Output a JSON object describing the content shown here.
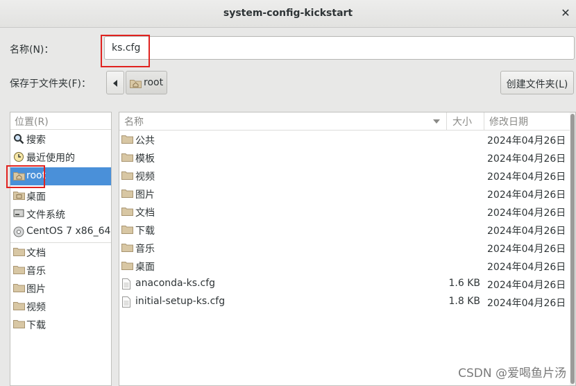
{
  "window": {
    "title": "system-config-kickstart"
  },
  "name_row": {
    "label": "名称(N)：",
    "value": "ks.cfg"
  },
  "folder_row": {
    "label": "保存于文件夹(F)：",
    "current": "root",
    "new_folder_label": "创建文件夹(L)"
  },
  "sidebar": {
    "header": "位置(R)",
    "items": [
      {
        "label": "搜索",
        "icon": "search-icon"
      },
      {
        "label": "最近使用的",
        "icon": "recent-icon"
      },
      {
        "label": "root",
        "icon": "home-folder-icon",
        "selected": true
      },
      {
        "label": "桌面",
        "icon": "desktop-folder-icon"
      },
      {
        "label": "文件系统",
        "icon": "drive-icon"
      },
      {
        "label": "CentOS 7 x86_64",
        "icon": "disc-icon"
      },
      {
        "label": "文档",
        "icon": "folder-icon"
      },
      {
        "label": "音乐",
        "icon": "folder-icon"
      },
      {
        "label": "图片",
        "icon": "folder-icon"
      },
      {
        "label": "视频",
        "icon": "folder-icon"
      },
      {
        "label": "下载",
        "icon": "folder-icon"
      }
    ]
  },
  "files": {
    "columns": {
      "name": "名称",
      "size": "大小",
      "modified": "修改日期"
    },
    "rows": [
      {
        "name": "公共",
        "size": "",
        "modified": "2024年04月26日",
        "type": "folder"
      },
      {
        "name": "模板",
        "size": "",
        "modified": "2024年04月26日",
        "type": "folder"
      },
      {
        "name": "视频",
        "size": "",
        "modified": "2024年04月26日",
        "type": "folder"
      },
      {
        "name": "图片",
        "size": "",
        "modified": "2024年04月26日",
        "type": "folder"
      },
      {
        "name": "文档",
        "size": "",
        "modified": "2024年04月26日",
        "type": "folder"
      },
      {
        "name": "下载",
        "size": "",
        "modified": "2024年04月26日",
        "type": "folder"
      },
      {
        "name": "音乐",
        "size": "",
        "modified": "2024年04月26日",
        "type": "folder"
      },
      {
        "name": "桌面",
        "size": "",
        "modified": "2024年04月26日",
        "type": "folder"
      },
      {
        "name": "anaconda-ks.cfg",
        "size": "1.6 KB",
        "modified": "2024年04月26日",
        "type": "file"
      },
      {
        "name": "initial-setup-ks.cfg",
        "size": "1.8 KB",
        "modified": "2024年04月26日",
        "type": "file"
      }
    ]
  },
  "watermark": "CSDN @爱喝鱼片汤",
  "colors": {
    "selection": "#4a90d9",
    "highlight_box": "#e0221f"
  }
}
